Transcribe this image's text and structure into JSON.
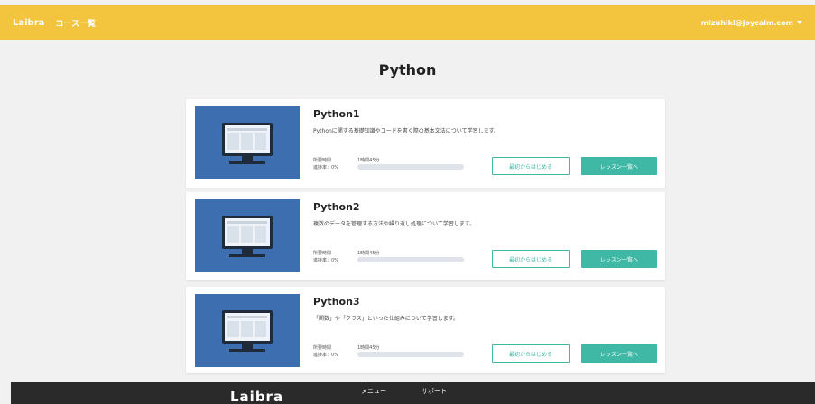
{
  "navbar": {
    "brand": "Laibra",
    "course_list": "コース一覧",
    "user_email": "mizuhiki@joycalm.com"
  },
  "page": {
    "title": "Python"
  },
  "courses": [
    {
      "title": "Python1",
      "description": "Pythonに関する基礎知識やコードを書く際の基本文法について学習します。",
      "time_label": "所要時間",
      "progress_label": "進捗率：0%",
      "time_value": "1時間45分",
      "progress": 0,
      "start_button": "最初からはじめる",
      "lessons_button": "レッスン一覧へ"
    },
    {
      "title": "Python2",
      "description": "複数のデータを管理する方法や繰り返し処理について学習します。",
      "time_label": "所要時間",
      "progress_label": "進捗率：0%",
      "time_value": "1時間45分",
      "progress": 0,
      "start_button": "最初からはじめる",
      "lessons_button": "レッスン一覧へ"
    },
    {
      "title": "Python3",
      "description": "「関数」や「クラス」といった仕組みについて学習します。",
      "time_label": "所要時間",
      "progress_label": "進捗率：0%",
      "time_value": "1時間45分",
      "progress": 0,
      "start_button": "最初からはじめる",
      "lessons_button": "レッスン一覧へ"
    }
  ],
  "footer": {
    "logo": "Laibra",
    "menu": "メニュー",
    "support": "サポート"
  },
  "colors": {
    "navbar": "#f3c43d",
    "accent": "#3fb8a5",
    "thumbnail": "#3d6eb0",
    "footer": "#2a2a2a"
  }
}
